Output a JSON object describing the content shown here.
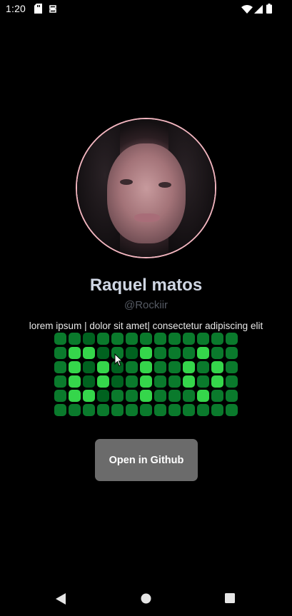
{
  "status_bar": {
    "time": "1:20",
    "icons": [
      "sd-card-icon",
      "sync-icon",
      "wifi-icon",
      "signal-icon",
      "battery-icon"
    ]
  },
  "profile": {
    "name": "Raquel matos",
    "handle": "@Rockiir",
    "bio": "lorem ipsum | dolor sit amet| consectetur adipiscing elit",
    "avatar_border_color": "#f2b5bf"
  },
  "contribution_grid": {
    "columns": 13,
    "rows": 6,
    "colors": {
      "dark": "#00621f",
      "base": "#0a7a2c",
      "mid": "#148f37",
      "lit": "#35d64b"
    },
    "cells": [
      [
        "base",
        "base",
        "dark",
        "base",
        "base",
        "base",
        "base",
        "base",
        "base",
        "base",
        "base",
        "base",
        "base"
      ],
      [
        "base",
        "lit",
        "lit",
        "dark",
        "base",
        "dark",
        "lit",
        "base",
        "base",
        "base",
        "lit",
        "base",
        "base"
      ],
      [
        "base",
        "lit",
        "dark",
        "lit",
        "dark",
        "base",
        "lit",
        "base",
        "base",
        "lit",
        "base",
        "lit",
        "base"
      ],
      [
        "base",
        "lit",
        "dark",
        "lit",
        "dark",
        "base",
        "lit",
        "base",
        "base",
        "lit",
        "base",
        "lit",
        "base"
      ],
      [
        "base",
        "lit",
        "lit",
        "dark",
        "base",
        "base",
        "lit",
        "base",
        "base",
        "base",
        "lit",
        "base",
        "base"
      ],
      [
        "base",
        "base",
        "base",
        "base",
        "base",
        "base",
        "base",
        "base",
        "base",
        "base",
        "base",
        "base",
        "base"
      ]
    ]
  },
  "actions": {
    "open_github_label": "Open in Github"
  },
  "nav_bar": {
    "buttons": [
      "back-icon",
      "home-icon",
      "recents-icon"
    ]
  }
}
